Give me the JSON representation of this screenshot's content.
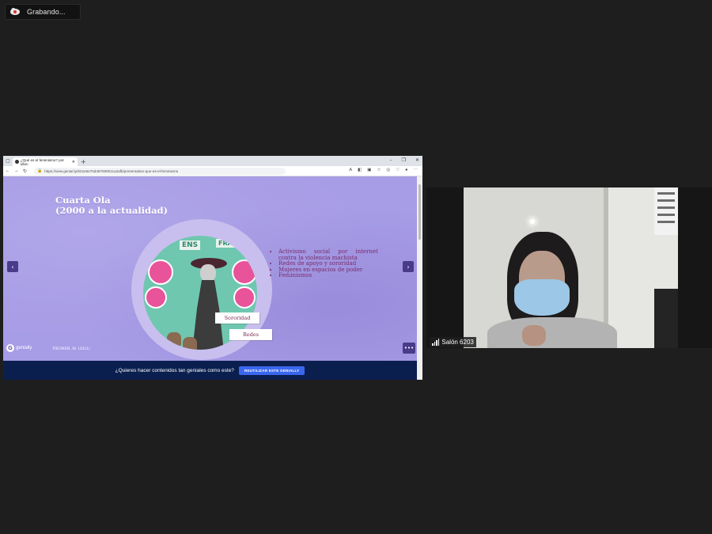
{
  "recording": {
    "label": "Grabando...",
    "icon": "cloud-record-icon"
  },
  "browser": {
    "tab_title": "¿Qué es el feminismo? por silvic",
    "new_tab": "+",
    "url": "https://view.genial.ly/622e5e70d487690011a2afb/presentation-que-es-el-feminismo",
    "window_controls": [
      "–",
      "❐",
      "✕"
    ]
  },
  "slide": {
    "title_line1": "Cuarta Ola",
    "title_line2": "(2000 a la actualidad)",
    "bullets": [
      "Activismo social por internet contra la violencia machista",
      "Redes de apoyo y sororidad",
      "Mujeres en espacios de poder",
      "Feminismos"
    ],
    "tag_sororidad": "Sororidad",
    "tag_redes": "Redes",
    "sign_left": "ENS",
    "sign_right": "FRACS",
    "credit": "TIEONER, M. (2021)",
    "logo_text": "genially",
    "more": "•••"
  },
  "banner": {
    "text": "¿Quieres hacer contenidos tan geniales como este?",
    "button": "REUTILIZAR ESTE GENIALLY"
  },
  "participant": {
    "name": "Salón 6203",
    "signal_icon": "signal-bars-icon"
  }
}
